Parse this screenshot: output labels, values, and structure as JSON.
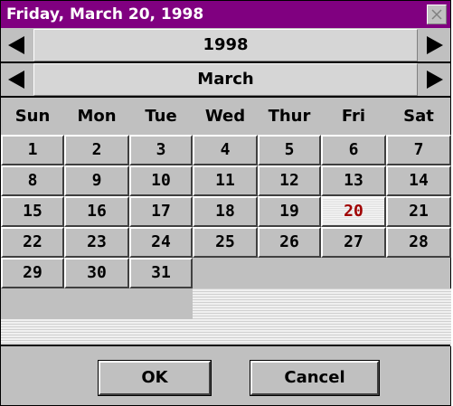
{
  "window": {
    "title": "Friday, March 20, 1998"
  },
  "year": {
    "value": "1998"
  },
  "month": {
    "value": "March"
  },
  "day_names": [
    "Sun",
    "Mon",
    "Tue",
    "Wed",
    "Thur",
    "Fri",
    "Sat"
  ],
  "days": [
    "1",
    "2",
    "3",
    "4",
    "5",
    "6",
    "7",
    "8",
    "9",
    "10",
    "11",
    "12",
    "13",
    "14",
    "15",
    "16",
    "17",
    "18",
    "19",
    "20",
    "21",
    "22",
    "23",
    "24",
    "25",
    "26",
    "27",
    "28",
    "29",
    "30",
    "31"
  ],
  "selected_day": "20",
  "selected_color": "#a00000",
  "buttons": {
    "ok": "OK",
    "cancel": "Cancel"
  },
  "icons": {
    "close": "close-icon",
    "prev": "arrow-left-icon",
    "next": "arrow-right-icon"
  }
}
